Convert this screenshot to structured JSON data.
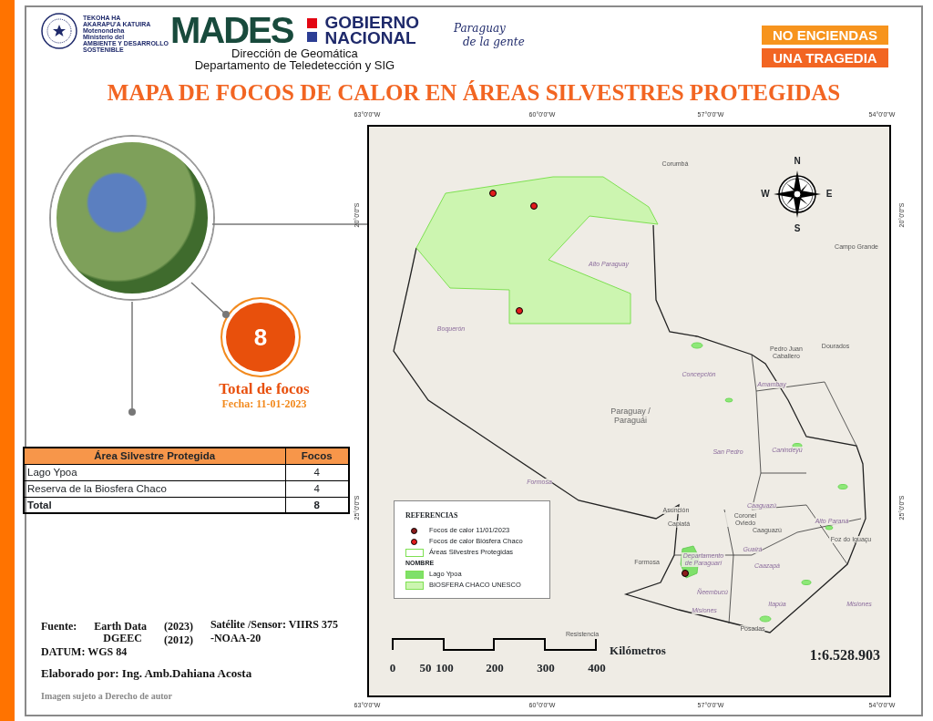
{
  "header": {
    "ministry_lines": [
      "TEKOHA HA",
      "AKARAPU'A KATUIRA",
      "Motenondeha",
      "Ministerio del",
      "AMBIENTE Y DESARROLLO",
      "SOSTENIBLE"
    ],
    "logo_text": "MADES",
    "government": [
      "GOBIERNO",
      "NACIONAL"
    ],
    "department": [
      "Dirección de Geomática",
      "Departamento de Teledetección y SIG"
    ],
    "slogan": [
      "Paraguay",
      "de la gente"
    ],
    "banners": [
      "NO ENCIENDAS",
      "UNA TRAGEDIA"
    ]
  },
  "title": "MAPA DE FOCOS DE CALOR EN ÁREAS SILVESTRES PROTEGIDAS",
  "summary": {
    "count": "8",
    "label": "Total de focos",
    "date": "Fecha: 11-01-2023"
  },
  "table": {
    "columns": [
      "Área Silvestre Protegida",
      "Focos"
    ],
    "rows": [
      {
        "kind": "normal",
        "cells": [
          "Lago Ypoa",
          "4"
        ]
      },
      {
        "kind": "normal",
        "cells": [
          "Reserva de la Biosfera Chaco",
          "4"
        ]
      },
      {
        "kind": "total",
        "cells": [
          "Total",
          "8"
        ]
      }
    ]
  },
  "credits": {
    "source_label": "Fuente:",
    "sources": [
      {
        "name": "Earth Data",
        "year": "(2023)"
      },
      {
        "name": "DGEEC",
        "year": "(2012)"
      }
    ],
    "sensor": [
      "Satélite /Sensor: VIIRS 375",
      "-NOAA-20"
    ],
    "datum": "DATUM: WGS 84",
    "author": "Elaborado por: Ing. Amb.Dahiana Acosta",
    "copyright": "Imagen sujeto a Derecho de autor"
  },
  "map": {
    "top_ticks": [
      "63°0'0\"W",
      "60°0'0\"W",
      "57°0'0\"W",
      "54°0'0\"W"
    ],
    "bottom_ticks": [
      "63°0'0\"W",
      "60°0'0\"W",
      "57°0'0\"W",
      "54°0'0\"W"
    ],
    "left_ticks": [
      "20°0'0\"S",
      "25°0'0\"S"
    ],
    "right_ticks": [
      "20°0'0\"S",
      "25°0'0\"S"
    ],
    "compass": [
      "N",
      "E",
      "S",
      "W"
    ],
    "places": [
      {
        "kind": "city",
        "text": "Corumbá"
      },
      {
        "kind": "city",
        "text": "Campo Grande"
      },
      {
        "kind": "region",
        "text": "Alto Paraguay"
      },
      {
        "kind": "region",
        "text": "Boquerón"
      },
      {
        "kind": "city",
        "text": "Pedro Juan Caballero"
      },
      {
        "kind": "city",
        "text": "Dourados"
      },
      {
        "kind": "region",
        "text": "Concepción"
      },
      {
        "kind": "region",
        "text": "Amambay"
      },
      {
        "kind": "country",
        "text": "Paraguay / Paraguái"
      },
      {
        "kind": "region",
        "text": "San Pedro"
      },
      {
        "kind": "region",
        "text": "Canindeyú"
      },
      {
        "kind": "region",
        "text": "Formosa"
      },
      {
        "kind": "region",
        "text": "Caaguazú"
      },
      {
        "kind": "city",
        "text": "Asunción"
      },
      {
        "kind": "city",
        "text": "Coronel Oviedo"
      },
      {
        "kind": "city",
        "text": "Capiatá"
      },
      {
        "kind": "city",
        "text": "Caaguazú"
      },
      {
        "kind": "region",
        "text": "Alto Paraná"
      },
      {
        "kind": "city",
        "text": "Foz do Iguaçu"
      },
      {
        "kind": "region",
        "text": "Departamento de Paraguarí"
      },
      {
        "kind": "region",
        "text": "Guairá"
      },
      {
        "kind": "city",
        "text": "Formosa"
      },
      {
        "kind": "region",
        "text": "Caazapá"
      },
      {
        "kind": "region",
        "text": "Ñeembucú"
      },
      {
        "kind": "region",
        "text": "Itapúa"
      },
      {
        "kind": "region",
        "text": "Misiones"
      },
      {
        "kind": "region",
        "text": "Misiones"
      },
      {
        "kind": "city",
        "text": "Resistencia"
      },
      {
        "kind": "city",
        "text": "Posadas"
      }
    ],
    "legend": {
      "title": "REFERENCIAS",
      "items": [
        {
          "kind": "dot",
          "label": "Focos de calor 11/01/2023",
          "color": "#8c1c1c"
        },
        {
          "kind": "dot",
          "label": "Focos de calor Biósfera Chaco",
          "color": "#e31a1c"
        },
        {
          "kind": "outline",
          "label": "Áreas Silvestres Protegidas"
        },
        {
          "kind": "heading",
          "label": "NOMBRE"
        },
        {
          "kind": "area",
          "label": "Lago Ypoa",
          "color": "#7fe06a"
        },
        {
          "kind": "area",
          "label": "BIOSFERA CHACO UNESCO",
          "color": "#ccf5b0"
        }
      ]
    },
    "scale": {
      "ticks": [
        "0",
        "50",
        "100",
        "200",
        "300",
        "400"
      ],
      "unit": "Kilómetros",
      "ratio": "1:6.528.903"
    }
  }
}
